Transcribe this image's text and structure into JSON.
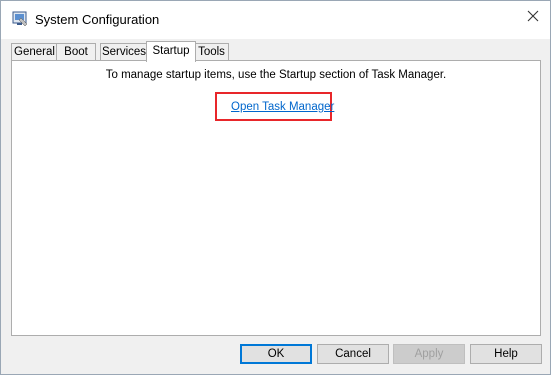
{
  "window": {
    "title": "System Configuration"
  },
  "tabs": [
    {
      "label": "General",
      "active": false
    },
    {
      "label": "Boot",
      "active": false
    },
    {
      "label": "Services",
      "active": false
    },
    {
      "label": "Startup",
      "active": true
    },
    {
      "label": "Tools",
      "active": false
    }
  ],
  "startup": {
    "instruction": "To manage startup items, use the Startup section of Task Manager.",
    "link_label": "Open Task Manager"
  },
  "buttons": {
    "ok": "OK",
    "cancel": "Cancel",
    "apply": "Apply",
    "help": "Help"
  },
  "colors": {
    "link": "#0066cc",
    "highlight": "#e8262a",
    "default_button_border": "#0078d7"
  },
  "icons": {
    "app": "msconfig-icon",
    "close": "close-icon"
  }
}
